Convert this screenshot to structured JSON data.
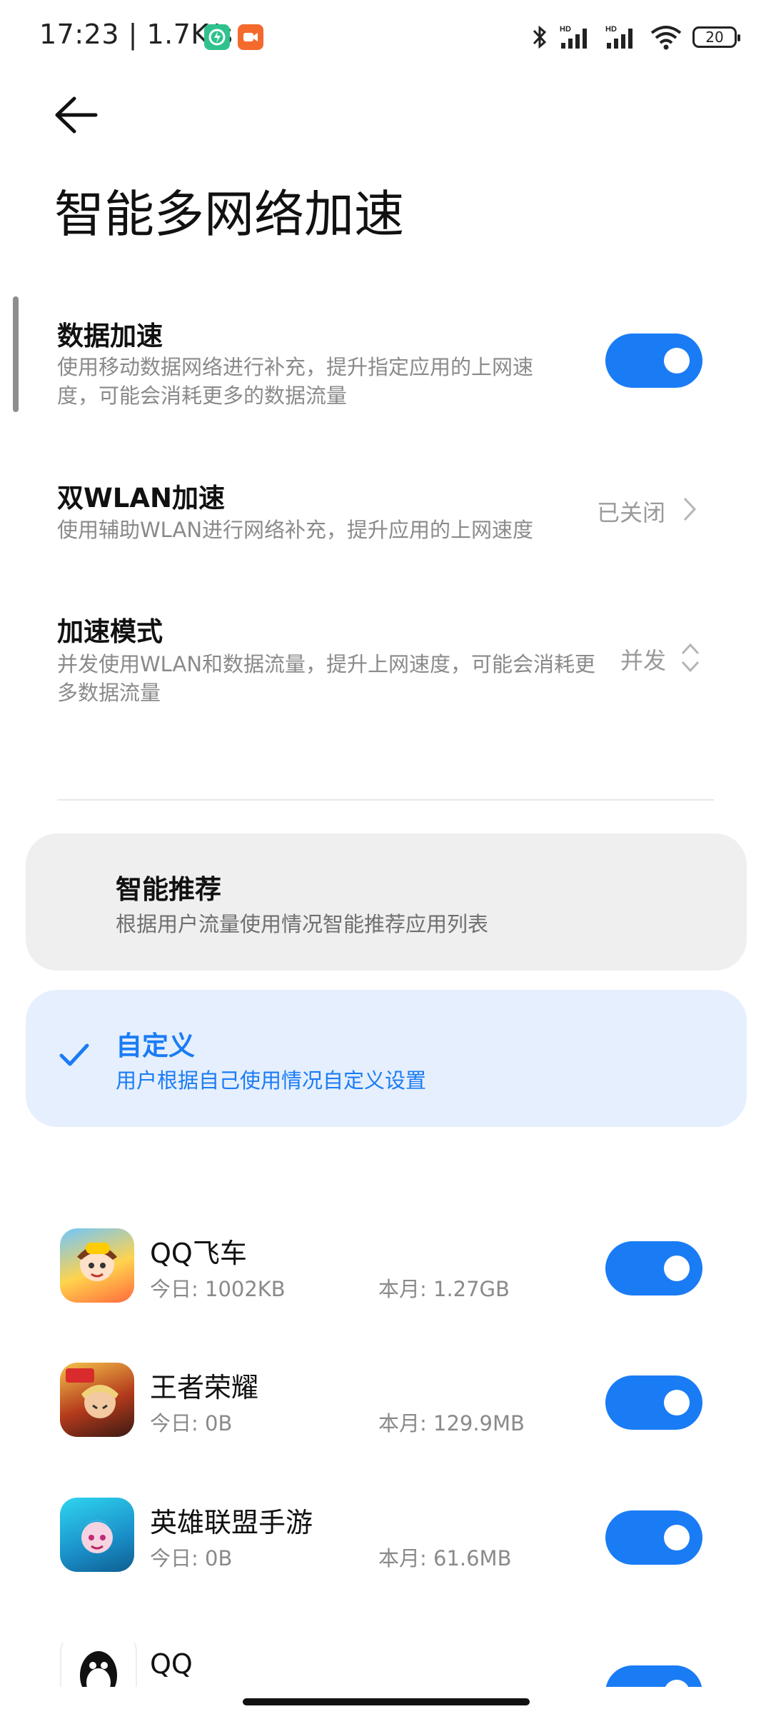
{
  "status_bar": {
    "time": "17:23",
    "net_speed": "1.7K/s",
    "battery": "20",
    "icons": [
      "bluetooth-icon",
      "signal-hd-1-icon",
      "signal-hd-2-icon",
      "wifi-icon",
      "battery-icon"
    ]
  },
  "page": {
    "title": "智能多网络加速"
  },
  "data_accel": {
    "title": "数据加速",
    "desc": "使用移动数据网络进行补充，提升指定应用的上网速度，可能会消耗更多的数据流量",
    "enabled": true
  },
  "dual_wlan": {
    "title": "双WLAN加速",
    "desc": "使用辅助WLAN进行网络补充，提升应用的上网速度",
    "value": "已关闭"
  },
  "accel_mode": {
    "title": "加速模式",
    "desc": "并发使用WLAN和数据流量，提升上网速度，可能会消耗更多数据流量",
    "value": "并发"
  },
  "options": [
    {
      "title": "智能推荐",
      "desc": "根据用户流量使用情况智能推荐应用列表",
      "selected": false
    },
    {
      "title": "自定义",
      "desc": "用户根据自己使用情况自定义设置",
      "selected": true
    }
  ],
  "apps": [
    {
      "name": "QQ飞车",
      "today": "今日: 1002KB",
      "month": "本月: 1.27GB",
      "enabled": true
    },
    {
      "name": "王者荣耀",
      "today": "今日: 0B",
      "month": "本月: 129.9MB",
      "enabled": true
    },
    {
      "name": "英雄联盟手游",
      "today": "今日: 0B",
      "month": "本月: 61.6MB",
      "enabled": true
    },
    {
      "name": "QQ",
      "enabled": true
    }
  ],
  "colors": {
    "accent": "#1a7cf5",
    "card_gray": "#efefef",
    "card_selected": "#e6effd"
  }
}
